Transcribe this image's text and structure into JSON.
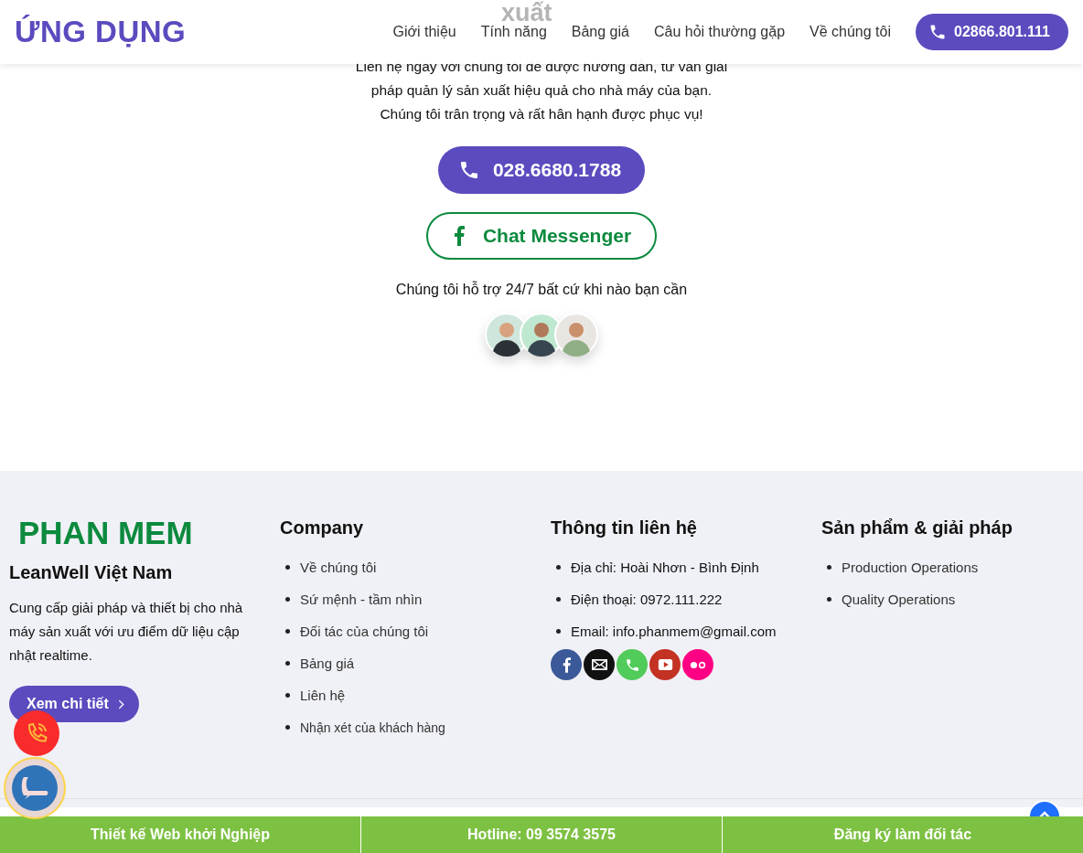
{
  "header": {
    "logo": "ỨNG DỤNG",
    "nav": [
      {
        "label": "Giới thiệu"
      },
      {
        "label": "Tính năng"
      },
      {
        "label": "Bảng giá"
      },
      {
        "label": "Câu hỏi thường gặp"
      },
      {
        "label": "Về chúng tôi"
      }
    ],
    "phone_button": "02866.801.111",
    "hidden_heading": "xuất"
  },
  "contact": {
    "intro": [
      "Liên hệ ngay với chúng tôi để được hướng dẫn, tư vấn giải pháp quản lý sản xuất hiệu quả cho nhà máy của bạn.",
      "Chúng tôi trân trọng và rất hân hạnh được phục vụ!"
    ],
    "call_button": "028.6680.1788",
    "messenger_button": "Chat Messenger",
    "support_note": "Chúng tôi hỗ trợ 24/7 bất cứ khi nào bạn cần",
    "avatars": [
      {
        "kind": "picture"
      },
      {
        "kind": "picture"
      },
      {
        "kind": "picture"
      }
    ]
  },
  "footer": {
    "brand": {
      "logo": "PHAN MEM",
      "name": "LeanWell Việt Nam",
      "description": "Cung cấp giải pháp và thiết bị cho nhà máy sản xuất với ưu điểm dữ liệu cập nhật realtime.",
      "button": "Xem chi tiết"
    },
    "company": {
      "title": "Company",
      "links": [
        "Về chúng tôi",
        "Sứ mệnh - tầm nhìn",
        "Đối tác của chúng tôi",
        "Bảng giá",
        "Liên hệ",
        "Nhận xét của khách hàng"
      ]
    },
    "contact_info": {
      "title": "Thông tin liên hệ",
      "items": [
        "Địa chỉ: Hoài Nhơn - Bình Định",
        "Điện thoại: 0972.111.222",
        "Email: info.phanmem@gmail.com"
      ],
      "social": [
        {
          "kind": "facebook",
          "color": "#3b5998"
        },
        {
          "kind": "email",
          "color": "#111111"
        },
        {
          "kind": "phone",
          "color": "#51cb5a"
        },
        {
          "kind": "youtube",
          "color": "#c33223"
        },
        {
          "kind": "flickr",
          "color": "#ff0084"
        }
      ]
    },
    "products": {
      "title": "Sản phẩm & giải pháp",
      "links": [
        "Production Operations",
        "Quality Operations"
      ]
    }
  },
  "bottom_bar": [
    "Thiết kế Web khởi Nghiệp",
    "Hotline: 09 3574 3575",
    "Đăng ký làm đối tác"
  ]
}
